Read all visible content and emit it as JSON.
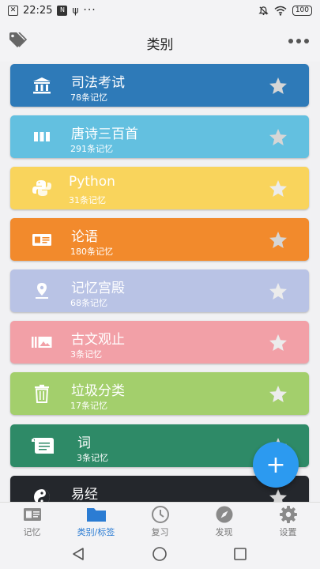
{
  "status_bar": {
    "time": "22:25",
    "battery": "100",
    "left_icons": [
      "close-box-icon",
      "nfc-icon",
      "usb-icon",
      "more-dots-icon"
    ],
    "right_icons": [
      "mute-icon",
      "wifi-icon",
      "battery-icon"
    ]
  },
  "header": {
    "title": "类别",
    "left_icon": "tag-icon",
    "right_icon": "more-icon"
  },
  "categories": [
    {
      "title": "司法考试",
      "subtitle": "78条记忆",
      "color": "#2e7ab8",
      "icon": "bank-icon",
      "star_color": "#d6d6d6"
    },
    {
      "title": "唐诗三百首",
      "subtitle": "291条记忆",
      "color": "#63c0e0",
      "icon": "columns-icon",
      "star_color": "#d6d6d6"
    },
    {
      "title": "Python",
      "subtitle": "31条记忆",
      "color": "#f9d45c",
      "icon": "python-icon",
      "star_color": "#e8e8e8"
    },
    {
      "title": "论语",
      "subtitle": "180条记忆",
      "color": "#f28a2c",
      "icon": "card-icon",
      "star_color": "#d6d6d6"
    },
    {
      "title": "记忆宫殿",
      "subtitle": "68条记忆",
      "color": "#b9c3e5",
      "icon": "location-pin-icon",
      "star_color": "#e8e8e8"
    },
    {
      "title": "古文观止",
      "subtitle": "3条记忆",
      "color": "#f2a0a7",
      "icon": "gallery-icon",
      "star_color": "#e8e8e8"
    },
    {
      "title": "垃圾分类",
      "subtitle": "17条记忆",
      "color": "#a3cf6c",
      "icon": "trash-icon",
      "star_color": "#e8e8e8"
    },
    {
      "title": "词",
      "subtitle": "3条记忆",
      "color": "#2e8a67",
      "icon": "scroll-icon",
      "star_color": "#d6d6d6"
    },
    {
      "title": "易经",
      "subtitle": "",
      "color": "#24272c",
      "icon": "yin-yang-icon",
      "star_color": "#d6d6d6"
    }
  ],
  "fab": {
    "label": "+",
    "color": "#2c9af0"
  },
  "bottom_nav": [
    {
      "label": "记忆",
      "icon": "memory-card-icon",
      "active": false
    },
    {
      "label": "类别/标签",
      "icon": "folder-icon",
      "active": true
    },
    {
      "label": "复习",
      "icon": "clock-icon",
      "active": false
    },
    {
      "label": "发现",
      "icon": "compass-icon",
      "active": false
    },
    {
      "label": "设置",
      "icon": "gear-icon",
      "active": false
    }
  ],
  "system_nav": [
    "back-icon",
    "home-icon",
    "recents-icon"
  ],
  "colors": {
    "accent": "#2b7cd3",
    "nav_inactive": "#777777"
  }
}
